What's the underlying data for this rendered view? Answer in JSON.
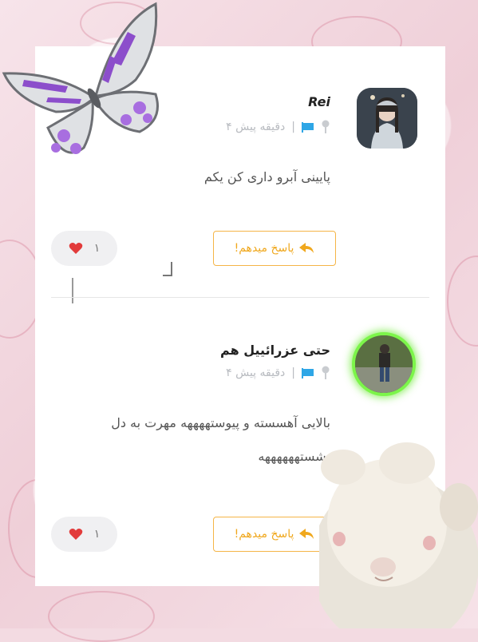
{
  "comments": [
    {
      "name": "Rei",
      "time": "۴ دقیقه پیش",
      "text": "پایینی آبرو داری کن یکم",
      "reply_label": "پاسخ میدهم!",
      "likes": "۱"
    },
    {
      "name": "حتی عزرائییل هم",
      "time": "۴ دقیقه پیش",
      "text": "بالایی آهسسته و پیوستههههه مهرت به دل نشستههههههه",
      "reply_label": "پاسخ میدهم!",
      "likes": "۱"
    }
  ],
  "colors": {
    "accent": "#f0a81e",
    "flag": "#2ea6e6",
    "heart": "#e23b3b",
    "glow": "#7cf54a"
  },
  "icons": [
    "pin-icon",
    "flag-icon",
    "reply-arrow-icon",
    "heart-icon"
  ]
}
